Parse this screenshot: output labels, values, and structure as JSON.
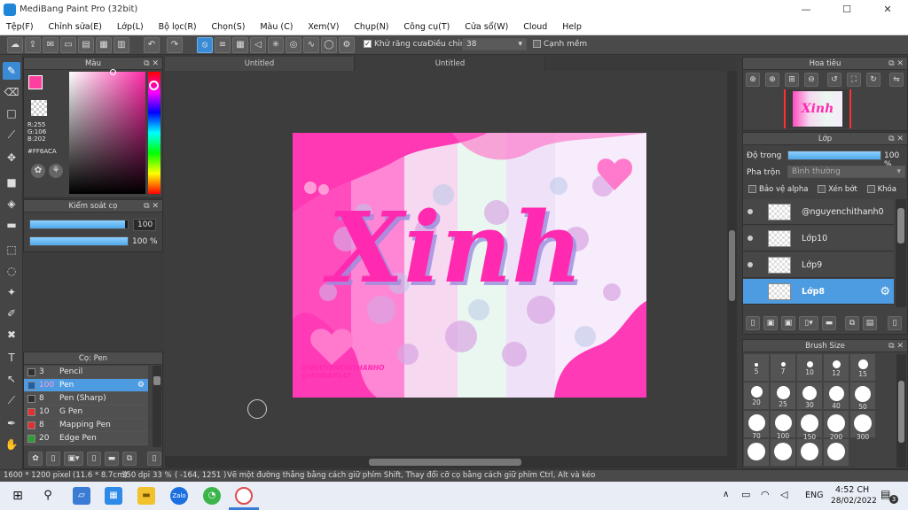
{
  "window": {
    "title": "MediBang Paint Pro (32bit)",
    "minimize": "—",
    "maximize": "☐",
    "close": "✕"
  },
  "menu": [
    "Tệp(F)",
    "Chỉnh sửa(E)",
    "Lớp(L)",
    "Bộ lọc(R)",
    "Chọn(S)",
    "Màu (C)",
    "Xem(V)",
    "Chụp(N)",
    "Công cụ(T)",
    "Cửa sổ(W)",
    "Cloud",
    "Help"
  ],
  "toolbar": {
    "antialias_label": "Khử răng cưa",
    "adjust_label": "Điều chỉnh",
    "adjust_value": "38",
    "edge_label": "Cạnh mềm"
  },
  "color_panel": {
    "title": "Màu",
    "r": "R:255",
    "g": "G:106",
    "b": "B:202",
    "hex": "#FF6ACA",
    "primary_color": "#ff3fa0"
  },
  "brush_control": {
    "title": "Kiểm soát cọ",
    "size_value": "100",
    "size_fraction": 0.97,
    "opacity_value": "100 %",
    "opacity_fraction": 1.0
  },
  "brush_list": {
    "title": "Cọ: Pen",
    "items": [
      {
        "size": "3",
        "name": "Pencil",
        "color": "#303030"
      },
      {
        "size": "100",
        "name": "Pen",
        "color": "#1b5fa8"
      },
      {
        "size": "8",
        "name": "Pen (Sharp)",
        "color": "#303030"
      },
      {
        "size": "10",
        "name": "G Pen",
        "color": "#e03030"
      },
      {
        "size": "8",
        "name": "Mapping Pen",
        "color": "#e03030"
      },
      {
        "size": "20",
        "name": "Edge Pen",
        "color": "#2aa030"
      }
    ]
  },
  "tabs": [
    "Untitled",
    "Untitled"
  ],
  "artwork": {
    "word": "Xinh",
    "credit_line1": "@NGUYENCHITHANHO",
    "credit_line2": "@HOIDAP247"
  },
  "navigator": {
    "title": "Hoa tiêu"
  },
  "layers": {
    "title": "Lớp",
    "opacity_label": "Độ trong",
    "opacity_value": "100 %",
    "blend_label": "Pha trộn",
    "blend_value": "Bình thường",
    "protect_alpha": "Bảo vệ alpha",
    "clipping": "Xén bớt",
    "lock": "Khóa",
    "items": [
      {
        "name": "@nguyenchithanh0",
        "selected": false
      },
      {
        "name": "Lớp10",
        "selected": false
      },
      {
        "name": "Lớp9",
        "selected": false
      },
      {
        "name": "Lớp8",
        "selected": true
      }
    ]
  },
  "brush_size": {
    "title": "Brush Size",
    "rows": [
      [
        "5",
        "7",
        "10",
        "12",
        "15"
      ],
      [
        "20",
        "25",
        "30",
        "40",
        "50"
      ],
      [
        "70",
        "100",
        "150",
        "200",
        "300"
      ]
    ]
  },
  "status": {
    "dimensions": "1600 * 1200 pixel",
    "physical": "(11.6 * 8.7cm)",
    "dpi": "350 dpi",
    "zoom": "33 %",
    "coords": "( -164, 1251 )",
    "hint": "Vẽ một đường thẳng bằng cách giữ phím Shift, Thay đổi cỡ cọ bằng cách giữ phím Ctrl, Alt và kéo"
  },
  "taskbar": {
    "lang": "ENG",
    "time": "4:52 CH",
    "date": "28/02/2022",
    "notif": "3"
  }
}
